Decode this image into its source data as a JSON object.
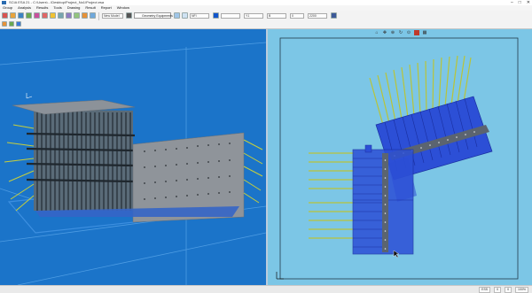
{
  "window": {
    "title": "SCIA ESA 21 - C:\\Users\\...\\Desktop\\Project_No1\\Project.esa",
    "controls": [
      "–",
      "□",
      "✕"
    ]
  },
  "menu": [
    "Group",
    "Analysis",
    "Results",
    "Tools",
    "Drawing",
    "Result",
    "Report",
    "Window"
  ],
  "toolbar": {
    "view_select": "New Model",
    "geometry_label": "Geometry Equipments",
    "layer_value": "NFI",
    "field_a": "Y1",
    "field_b": "B",
    "field_c": "0",
    "field_d": "2200"
  },
  "status": {
    "items": [
      "ESS",
      "0",
      "0",
      "100%"
    ]
  },
  "colors": {
    "viewport_3d": "#1b74c9",
    "viewport_2d": "#7cc6e6",
    "plate": "#8f949a",
    "anchor_bars": "#bfc93a",
    "highlight_blue": "#2b47d9"
  }
}
